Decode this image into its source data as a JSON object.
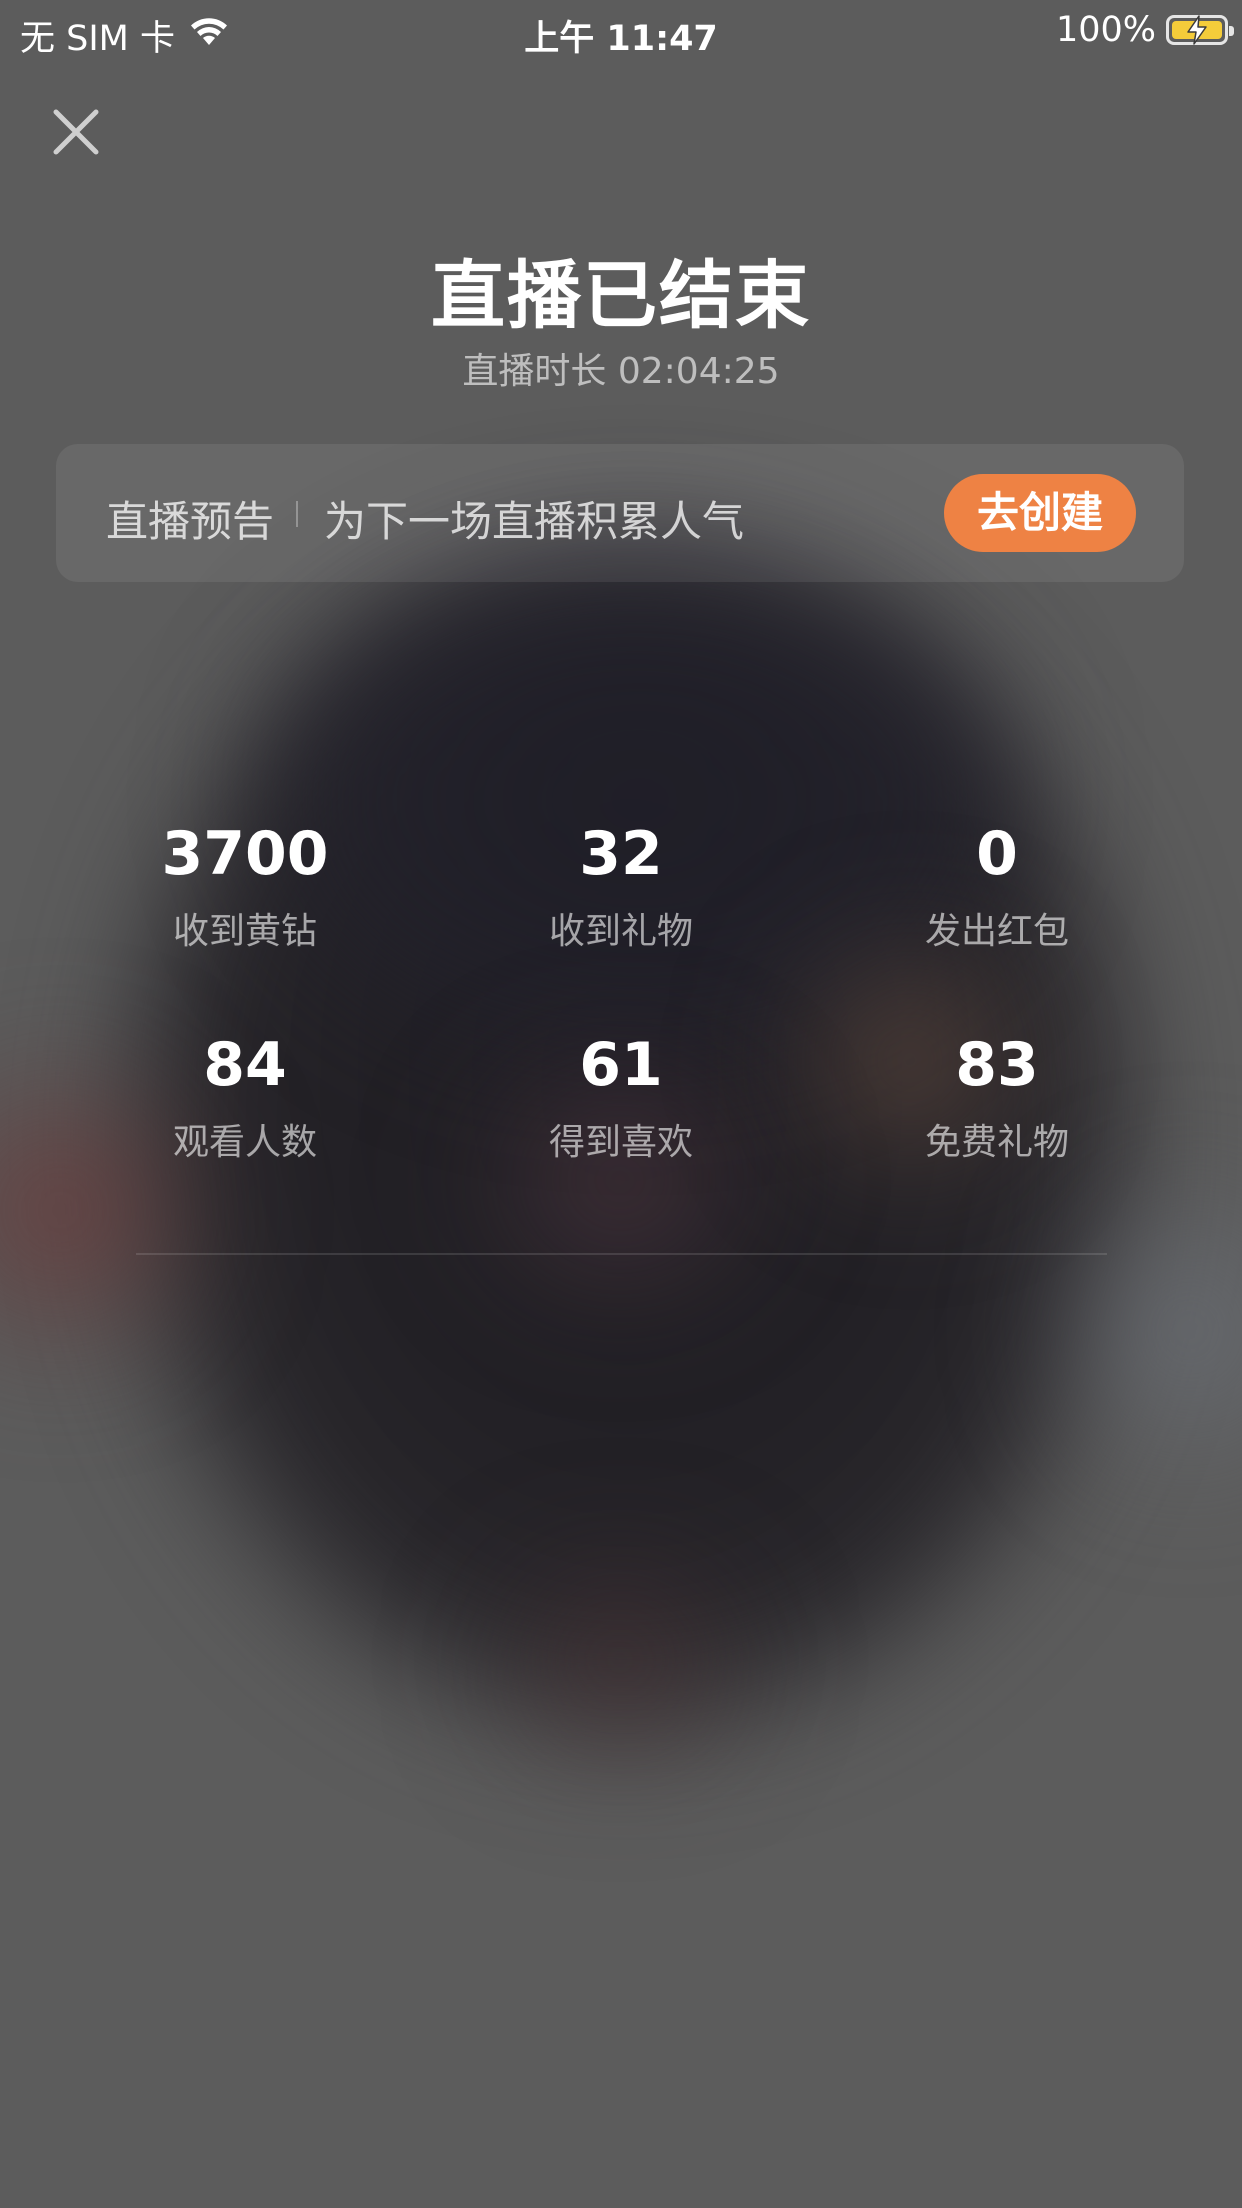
{
  "status_bar": {
    "carrier": "无 SIM 卡",
    "time": "上午 11:47",
    "battery": "100%",
    "battery_color": "#f4cc3a"
  },
  "icons": {
    "close": "close-icon",
    "wifi": "wifi-icon",
    "battery": "battery-charging-icon"
  },
  "header": {
    "title": "直播已结束",
    "duration": "直播时长 02:04:25"
  },
  "preview": {
    "label": "直播预告",
    "description": "为下一场直播积累人气",
    "button": "去创建",
    "button_color": "#ee8244"
  },
  "stats": [
    {
      "value": "3700",
      "label": "收到黄钻"
    },
    {
      "value": "32",
      "label": "收到礼物"
    },
    {
      "value": "0",
      "label": "发出红包"
    },
    {
      "value": "84",
      "label": "观看人数"
    },
    {
      "value": "61",
      "label": "得到喜欢"
    },
    {
      "value": "83",
      "label": "免费礼物"
    }
  ]
}
